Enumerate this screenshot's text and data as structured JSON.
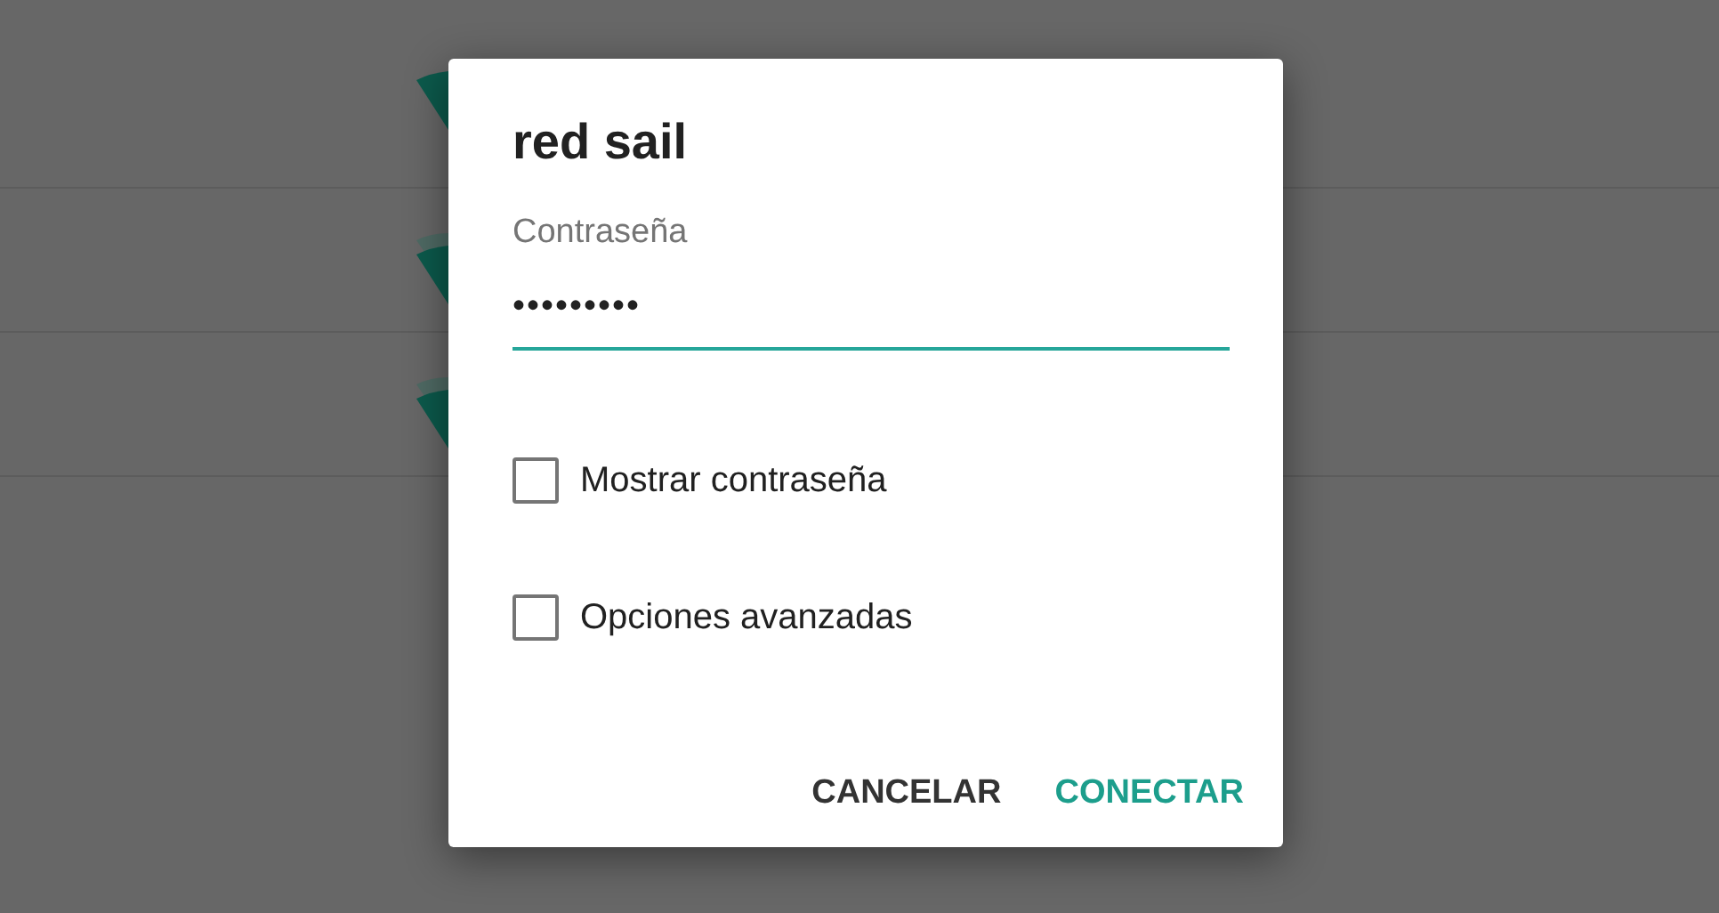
{
  "dialog": {
    "title": "red sail",
    "password": {
      "label": "Contraseña",
      "value": "•••••••••"
    },
    "options": [
      {
        "label": "Mostrar contraseña",
        "checked": false
      },
      {
        "label": "Opciones avanzadas",
        "checked": false
      }
    ],
    "buttons": [
      {
        "label": "CANCELAR",
        "kind": "neutral"
      },
      {
        "label": "CONECTAR",
        "kind": "primary"
      }
    ]
  }
}
